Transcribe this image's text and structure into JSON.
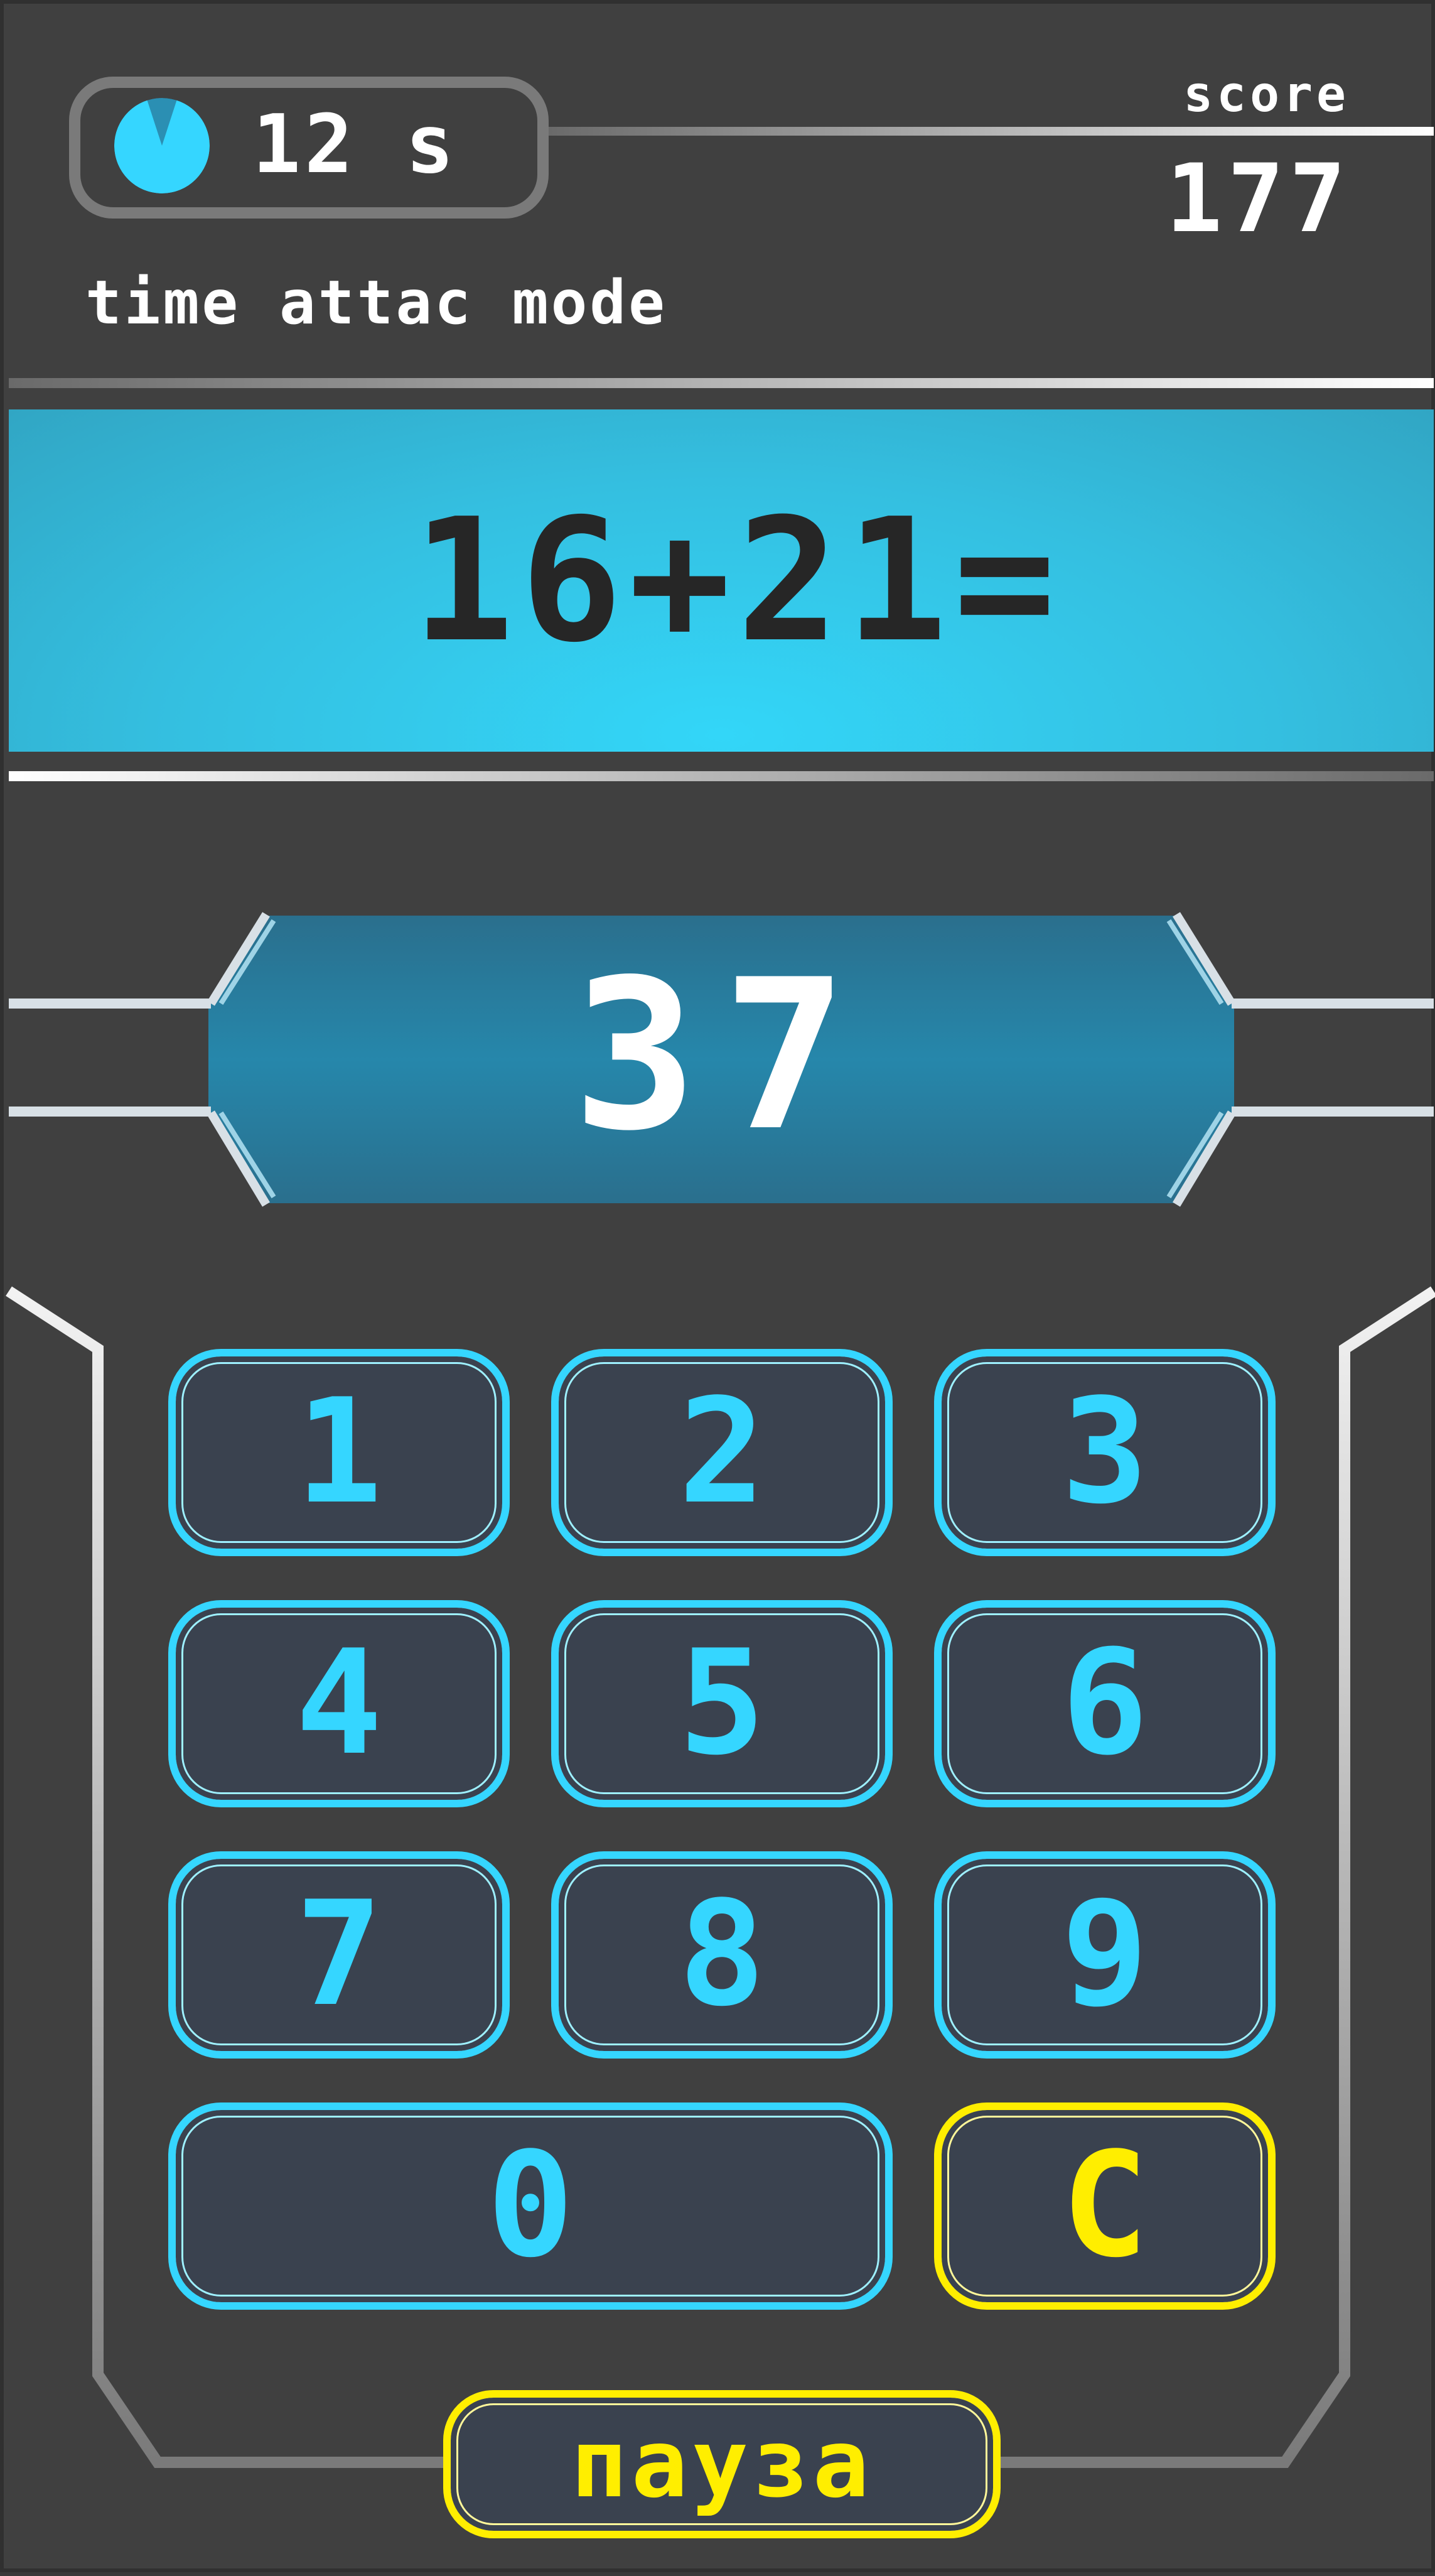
{
  "timer": {
    "value": "12",
    "unit": "s",
    "remaining_fraction": 0.9,
    "icon": "timer-dial-icon"
  },
  "score": {
    "label": "score",
    "value": "177"
  },
  "mode": {
    "label": "time attac mode"
  },
  "question": {
    "expression": "16+21="
  },
  "answer": {
    "value": "37"
  },
  "keypad": {
    "keys": [
      "1",
      "2",
      "3",
      "4",
      "5",
      "6",
      "7",
      "8",
      "9",
      "0"
    ],
    "clear_label": "C"
  },
  "pause": {
    "label": "пауза"
  },
  "colors": {
    "background": "#404040",
    "accent_cyan": "#35d6ff",
    "accent_yellow": "#ffee00",
    "key_fill": "#3a424f",
    "question_band": "#34c8ec",
    "answer_band": "#2b7fa0",
    "question_text": "#262626"
  }
}
